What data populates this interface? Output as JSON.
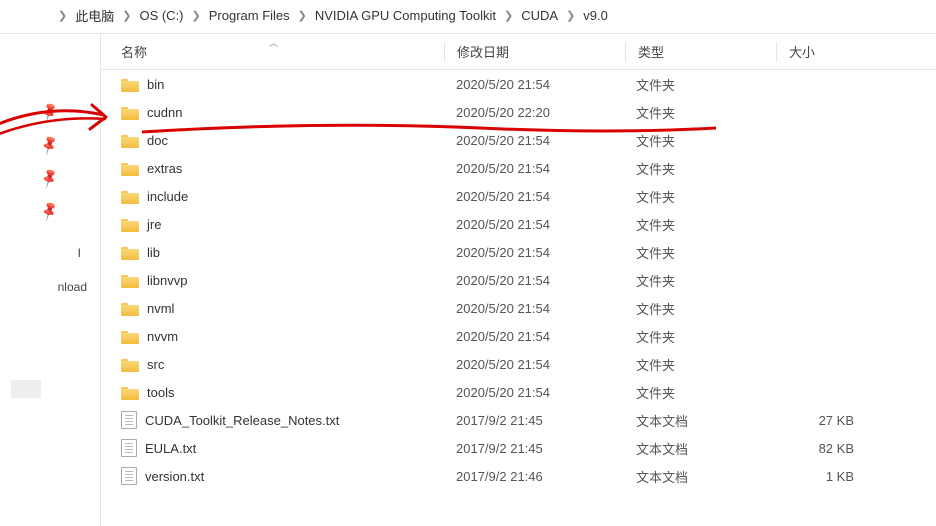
{
  "breadcrumb": [
    "此电脑",
    "OS (C:)",
    "Program Files",
    "NVIDIA GPU Computing Toolkit",
    "CUDA",
    "v9.0"
  ],
  "columns": {
    "name": "名称",
    "date": "修改日期",
    "type": "类型",
    "size": "大小"
  },
  "left": {
    "label1": "I",
    "label2": "nload"
  },
  "files": [
    {
      "name": "bin",
      "date": "2020/5/20 21:54",
      "type": "文件夹",
      "size": "",
      "kind": "folder"
    },
    {
      "name": "cudnn",
      "date": "2020/5/20 22:20",
      "type": "文件夹",
      "size": "",
      "kind": "folder"
    },
    {
      "name": "doc",
      "date": "2020/5/20 21:54",
      "type": "文件夹",
      "size": "",
      "kind": "folder"
    },
    {
      "name": "extras",
      "date": "2020/5/20 21:54",
      "type": "文件夹",
      "size": "",
      "kind": "folder"
    },
    {
      "name": "include",
      "date": "2020/5/20 21:54",
      "type": "文件夹",
      "size": "",
      "kind": "folder"
    },
    {
      "name": "jre",
      "date": "2020/5/20 21:54",
      "type": "文件夹",
      "size": "",
      "kind": "folder"
    },
    {
      "name": "lib",
      "date": "2020/5/20 21:54",
      "type": "文件夹",
      "size": "",
      "kind": "folder"
    },
    {
      "name": "libnvvp",
      "date": "2020/5/20 21:54",
      "type": "文件夹",
      "size": "",
      "kind": "folder"
    },
    {
      "name": "nvml",
      "date": "2020/5/20 21:54",
      "type": "文件夹",
      "size": "",
      "kind": "folder"
    },
    {
      "name": "nvvm",
      "date": "2020/5/20 21:54",
      "type": "文件夹",
      "size": "",
      "kind": "folder"
    },
    {
      "name": "src",
      "date": "2020/5/20 21:54",
      "type": "文件夹",
      "size": "",
      "kind": "folder"
    },
    {
      "name": "tools",
      "date": "2020/5/20 21:54",
      "type": "文件夹",
      "size": "",
      "kind": "folder"
    },
    {
      "name": "CUDA_Toolkit_Release_Notes.txt",
      "date": "2017/9/2 21:45",
      "type": "文本文档",
      "size": "27 KB",
      "kind": "file"
    },
    {
      "name": "EULA.txt",
      "date": "2017/9/2 21:45",
      "type": "文本文档",
      "size": "82 KB",
      "kind": "file"
    },
    {
      "name": "version.txt",
      "date": "2017/9/2 21:46",
      "type": "文本文档",
      "size": "1 KB",
      "kind": "file"
    }
  ]
}
